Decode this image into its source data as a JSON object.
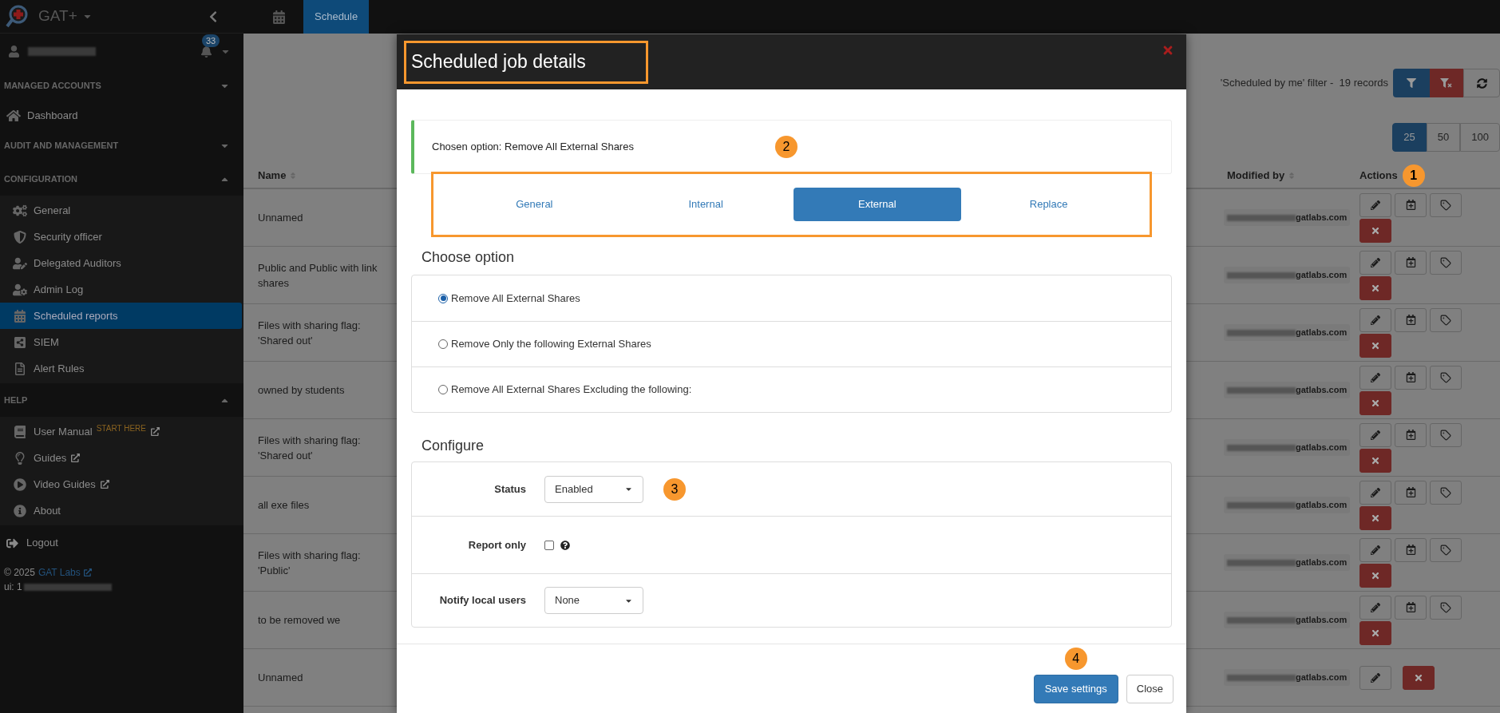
{
  "app": {
    "title": "GAT+",
    "notification_count": "33"
  },
  "sidebar": {
    "groups": [
      {
        "heading": "MANAGED ACCOUNTS",
        "expanded": false,
        "items": [
          {
            "label": "Dashboard",
            "selected": false
          }
        ]
      },
      {
        "heading": "AUDIT AND MANAGEMENT",
        "expanded": false
      },
      {
        "heading": "CONFIGURATION",
        "expanded": true,
        "items": [
          {
            "label": "General",
            "selected": false
          },
          {
            "label": "Security officer",
            "selected": false
          },
          {
            "label": "Delegated Auditors",
            "selected": false
          },
          {
            "label": "Admin Log",
            "selected": false
          },
          {
            "label": "Scheduled reports",
            "selected": true
          },
          {
            "label": "SIEM",
            "selected": false
          },
          {
            "label": "Alert Rules",
            "selected": false
          }
        ]
      },
      {
        "heading": "HELP",
        "expanded": true,
        "items": [
          {
            "label": "User Manual",
            "selected": false,
            "tag": "START HERE",
            "external": true
          },
          {
            "label": "Guides",
            "selected": false,
            "external": true
          },
          {
            "label": "Video Guides",
            "selected": false,
            "external": true
          },
          {
            "label": "About",
            "selected": false,
            "external": false
          }
        ]
      }
    ],
    "logout": "Logout",
    "copyright": "© 2025",
    "company_link": "GAT Labs",
    "ui_label": "ui: 1"
  },
  "top_tabs": [
    {
      "label": "Schedule",
      "selected": true
    }
  ],
  "toolbar": {
    "filter_text": "'Scheduled by me' filter -  19 records",
    "page_sizes": [
      {
        "label": "25",
        "selected": true
      },
      {
        "label": "50",
        "selected": false
      },
      {
        "label": "100",
        "selected": false
      }
    ]
  },
  "table": {
    "columns": [
      "Name",
      "Modified by",
      "Actions"
    ],
    "rows": [
      {
        "name": "Unnamed",
        "modified_by": "gatlabs.com",
        "full_actions": true
      },
      {
        "name": "Public and Public with link shares",
        "modified_by": "gatlabs.com",
        "full_actions": true
      },
      {
        "name": "Files with sharing flag: 'Shared out'",
        "modified_by": "gatlabs.com",
        "full_actions": true
      },
      {
        "name": "owned by students",
        "modified_by": "gatlabs.com",
        "full_actions": true
      },
      {
        "name": "Files with sharing flag: 'Shared out'",
        "modified_by": "gatlabs.com",
        "full_actions": true
      },
      {
        "name": "all exe files",
        "modified_by": "gatlabs.com",
        "full_actions": true
      },
      {
        "name": "Files with sharing flag: 'Public'",
        "modified_by": "gatlabs.com",
        "full_actions": true
      },
      {
        "name": "to be removed we",
        "modified_by": "gatlabs.com",
        "full_actions": true
      },
      {
        "name": "Unnamed",
        "modified_by": "gatlabs.com",
        "full_actions": false
      }
    ]
  },
  "modal": {
    "title": "Scheduled job details",
    "chosen_option": "Chosen option: Remove All External Shares",
    "tabs": [
      {
        "label": "General",
        "selected": false
      },
      {
        "label": "Internal",
        "selected": false
      },
      {
        "label": "External",
        "selected": true
      },
      {
        "label": "Replace",
        "selected": false
      }
    ],
    "choose_heading": "Choose option",
    "options": [
      {
        "label": "Remove All External Shares",
        "selected": true
      },
      {
        "label": "Remove Only the following External Shares",
        "selected": false
      },
      {
        "label": "Remove All External Shares Excluding the following:",
        "selected": false
      }
    ],
    "configure_heading": "Configure",
    "fields": [
      {
        "kind": "select",
        "label": "Status",
        "value": "Enabled"
      },
      {
        "kind": "checkbox",
        "label": "Report only",
        "checked": false
      },
      {
        "kind": "select",
        "label": "Notify local users",
        "value": "None"
      }
    ],
    "buttons": [
      "Save settings",
      "Close"
    ]
  },
  "annotations": [
    "1",
    "2",
    "3",
    "4"
  ]
}
